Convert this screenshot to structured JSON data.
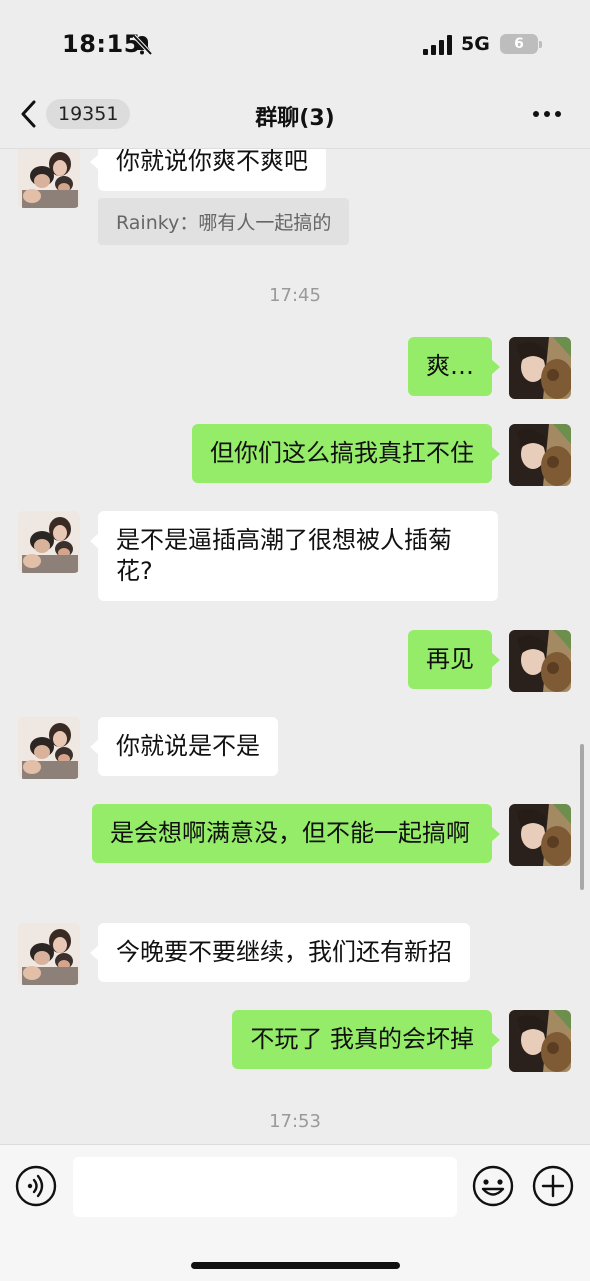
{
  "status_bar": {
    "time": "18:15",
    "network": "5G",
    "battery": "6"
  },
  "nav": {
    "unread_count": "19351",
    "title": "群聊(3)"
  },
  "messages": [
    {
      "side": "in",
      "text": "你就说你爽不爽吧"
    },
    {
      "side": "quote",
      "text": "Rainky：哪有人一起搞的"
    },
    {
      "side": "time",
      "text": "17:45"
    },
    {
      "side": "out",
      "text": "爽…"
    },
    {
      "side": "out",
      "text": "但你们这么搞我真扛不住"
    },
    {
      "side": "in",
      "text": "是不是逼插高潮了很想被人插菊花?"
    },
    {
      "side": "out",
      "text": "再见"
    },
    {
      "side": "in",
      "text": "你就说是不是"
    },
    {
      "side": "out",
      "text": "是会想啊满意没，但不能一起搞啊"
    },
    {
      "side": "in",
      "text": "今晚要不要继续，我们还有新招"
    },
    {
      "side": "out",
      "text": "不玩了 我真的会坏掉"
    },
    {
      "side": "time",
      "text": "17:53"
    }
  ],
  "input": {
    "value": "",
    "placeholder": ""
  },
  "icons": {
    "back": "chevron-left-icon",
    "more": "more-dots-icon",
    "mute": "bell-slash-icon",
    "voice": "voice-icon",
    "emoji": "emoji-icon",
    "plus": "plus-icon"
  },
  "colors": {
    "background": "#ededed",
    "bubble_out": "#95ec69",
    "bubble_in": "#ffffff"
  }
}
